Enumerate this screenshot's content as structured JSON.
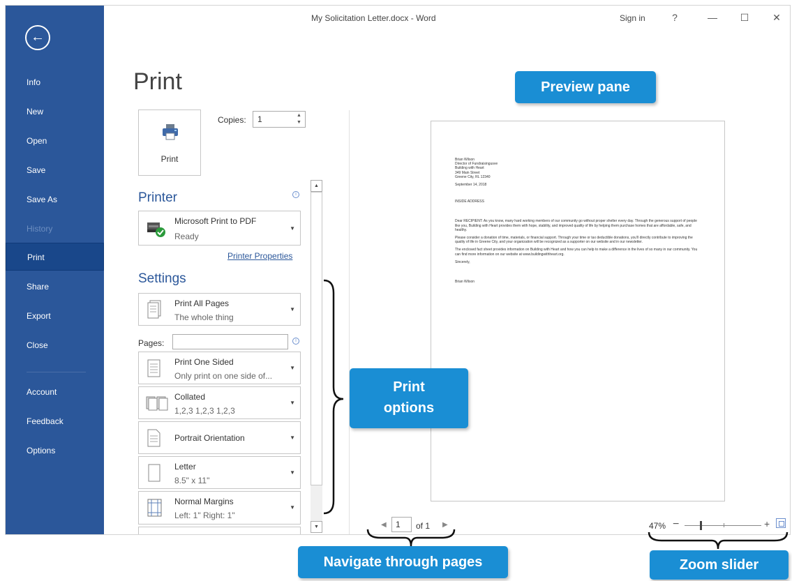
{
  "window": {
    "title": "My Solicitation Letter.docx - Word",
    "sign_in": "Sign in",
    "help": "?",
    "minimize": "—",
    "maximize": "☐",
    "close": "✕"
  },
  "sidebar": {
    "back": "←",
    "items": [
      {
        "label": "Info"
      },
      {
        "label": "New"
      },
      {
        "label": "Open"
      },
      {
        "label": "Save"
      },
      {
        "label": "Save As"
      },
      {
        "label": "History"
      },
      {
        "label": "Print"
      },
      {
        "label": "Share"
      },
      {
        "label": "Export"
      },
      {
        "label": "Close"
      },
      {
        "label": "Account"
      },
      {
        "label": "Feedback"
      },
      {
        "label": "Options"
      }
    ]
  },
  "print": {
    "title": "Print",
    "button_label": "Print",
    "copies_label": "Copies:",
    "copies_value": "1"
  },
  "printer": {
    "heading": "Printer",
    "name": "Microsoft Print to PDF",
    "status": "Ready",
    "properties_link": "Printer Properties"
  },
  "settings": {
    "heading": "Settings",
    "pages_label": "Pages:",
    "options": [
      {
        "main": "Print All Pages",
        "sub": "The whole thing"
      },
      {
        "main": "Print One Sided",
        "sub": "Only print on one side of..."
      },
      {
        "main": "Collated",
        "sub": "1,2,3   1,2,3   1,2,3"
      },
      {
        "main": "Portrait Orientation",
        "sub": ""
      },
      {
        "main": "Letter",
        "sub": "8.5\" x 11\""
      },
      {
        "main": "Normal Margins",
        "sub": "Left:  1\"   Right:  1\""
      }
    ]
  },
  "preview": {
    "doc": {
      "sender": [
        "Brian Wilson",
        "Director of Fundraisingusve",
        "Building with Heart",
        "349 Main Street",
        "Greene City, RL 12340"
      ],
      "date": "September 14, 2018",
      "inside_address": "INSIDE ADDRESS",
      "para1": "Dear RECIPIENT: As you know, many hard working members of our community go without proper shelter every day. Through the generous support of people like you, Building with Heart provides them with hope, stability, and improved quality of life by helping them purchase homes that are affordable, safe, and healthy.",
      "para2": "Please consider a donation of time, materials, or financial support. Through your time or tax deductible donations, you'll directly contribute to improving the quality of life in Greene City, and your organization will be recognized as a supporter on our website and in our newsletter.",
      "para3": "The enclosed fact sheet provides information on Building with Heart and how you can help to make a difference in the lives of so many in our community. You can find more information on our website at www.buildingwithheart.org.",
      "closing": "Sincerely,",
      "signature": "Brian Wilson"
    }
  },
  "page_nav": {
    "current": "1",
    "of_label": "of 1"
  },
  "zoom": {
    "percent": "47%",
    "minus": "−",
    "plus": "+"
  },
  "callouts": {
    "preview_pane": "Preview pane",
    "print_options_line1": "Print",
    "print_options_line2": "options",
    "navigate": "Navigate through pages",
    "zoom_slider": "Zoom slider"
  },
  "colors": {
    "sidebar": "#2b579a",
    "sidebar_active": "#19478a",
    "callout": "#1a8ed4",
    "heading": "#2b579a"
  }
}
